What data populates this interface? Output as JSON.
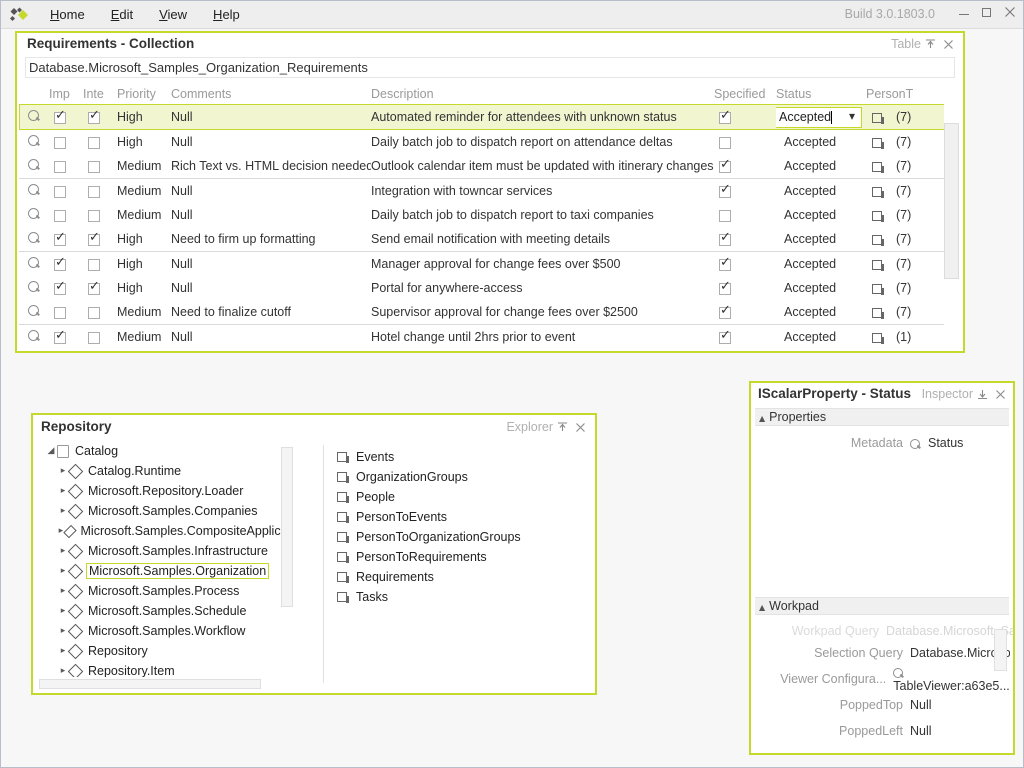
{
  "titlebar": {
    "logo_icon": "app-diamond-logo",
    "menus": [
      {
        "label": "Home",
        "accel": "H"
      },
      {
        "label": "Edit",
        "accel": "E"
      },
      {
        "label": "View",
        "accel": "V"
      },
      {
        "label": "Help",
        "accel": "H"
      }
    ],
    "build": "Build 3.0.1803.0",
    "minimize_icon": "minimize-icon",
    "maximize_icon": "maximize-icon",
    "close_icon": "close-icon"
  },
  "table_panel": {
    "title": "Requirements - Collection",
    "kind": "Table",
    "pin_icon": "pin-icon",
    "close_icon": "close-icon",
    "path": "Database.Microsoft_Samples_Organization_Requirements",
    "columns": [
      "",
      "Imp",
      "Inte",
      "Priority",
      "Comments",
      "Description",
      "Specified",
      "Status",
      "PersonT"
    ],
    "rows": [
      {
        "imp": true,
        "inte": true,
        "priority": "High",
        "comments": "Null",
        "description": "Automated reminder for attendees with unknown status",
        "specified": true,
        "status": "Accepted",
        "person": "(7)",
        "selected": true,
        "group_start": false
      },
      {
        "imp": false,
        "inte": false,
        "priority": "High",
        "comments": "Null",
        "description": "Daily batch job to dispatch report on attendance deltas",
        "specified": false,
        "status": "Accepted",
        "person": "(7)",
        "selected": false,
        "group_start": false
      },
      {
        "imp": false,
        "inte": false,
        "priority": "Medium",
        "comments": "Rich Text vs. HTML decision needed",
        "description": "Outlook calendar item must be updated with itinerary changes",
        "specified": true,
        "status": "Accepted",
        "person": "(7)",
        "selected": false,
        "group_start": false
      },
      {
        "imp": false,
        "inte": false,
        "priority": "Medium",
        "comments": "Null",
        "description": "Integration with towncar services",
        "specified": true,
        "status": "Accepted",
        "person": "(7)",
        "selected": false,
        "group_start": true
      },
      {
        "imp": false,
        "inte": false,
        "priority": "Medium",
        "comments": "Null",
        "description": "Daily batch job to dispatch report to taxi companies",
        "specified": false,
        "status": "Accepted",
        "person": "(7)",
        "selected": false,
        "group_start": false
      },
      {
        "imp": true,
        "inte": true,
        "priority": "High",
        "comments": "Need to firm up formatting",
        "description": "Send email notification with meeting details",
        "specified": true,
        "status": "Accepted",
        "person": "(7)",
        "selected": false,
        "group_start": false
      },
      {
        "imp": true,
        "inte": false,
        "priority": "High",
        "comments": "Null",
        "description": "Manager approval for change fees over $500",
        "specified": true,
        "status": "Accepted",
        "person": "(7)",
        "selected": false,
        "group_start": true
      },
      {
        "imp": true,
        "inte": true,
        "priority": "High",
        "comments": "Null",
        "description": "Portal for anywhere-access",
        "specified": true,
        "status": "Accepted",
        "person": "(7)",
        "selected": false,
        "group_start": false
      },
      {
        "imp": false,
        "inte": false,
        "priority": "Medium",
        "comments": "Need to finalize cutoff",
        "description": "Supervisor approval for change fees over $2500",
        "specified": true,
        "status": "Accepted",
        "person": "(7)",
        "selected": false,
        "group_start": false
      },
      {
        "imp": true,
        "inte": false,
        "priority": "Medium",
        "comments": "Null",
        "description": "Hotel change until 2hrs prior to event",
        "specified": true,
        "status": "Accepted",
        "person": "(1)",
        "selected": false,
        "group_start": true
      }
    ],
    "editing_status_value": "Accepted",
    "dropdown_icon": "chevron-down-icon",
    "row_action_icon": "magnifier-icon",
    "person_link_icon": "collection-icon"
  },
  "repository_panel": {
    "title": "Repository",
    "kind": "Explorer",
    "pin_icon": "pin-icon",
    "close_icon": "close-icon",
    "tree": [
      {
        "label": "Catalog",
        "level": 1,
        "icon": "book-icon",
        "expanded": true,
        "selected": false
      },
      {
        "label": "Catalog.Runtime",
        "level": 2,
        "icon": "diamond-icon",
        "expanded": false,
        "selected": false
      },
      {
        "label": "Microsoft.Repository.Loader",
        "level": 2,
        "icon": "diamond-icon",
        "expanded": false,
        "selected": false
      },
      {
        "label": "Microsoft.Samples.Companies",
        "level": 2,
        "icon": "diamond-icon",
        "expanded": false,
        "selected": false
      },
      {
        "label": "Microsoft.Samples.CompositeApplicat",
        "level": 2,
        "icon": "diamond-icon",
        "expanded": false,
        "selected": false
      },
      {
        "label": "Microsoft.Samples.Infrastructure",
        "level": 2,
        "icon": "diamond-icon",
        "expanded": false,
        "selected": false
      },
      {
        "label": "Microsoft.Samples.Organization",
        "level": 2,
        "icon": "diamond-icon",
        "expanded": false,
        "selected": true
      },
      {
        "label": "Microsoft.Samples.Process",
        "level": 2,
        "icon": "diamond-icon",
        "expanded": false,
        "selected": false
      },
      {
        "label": "Microsoft.Samples.Schedule",
        "level": 2,
        "icon": "diamond-icon",
        "expanded": false,
        "selected": false
      },
      {
        "label": "Microsoft.Samples.Workflow",
        "level": 2,
        "icon": "diamond-icon",
        "expanded": false,
        "selected": false
      },
      {
        "label": "Repository",
        "level": 2,
        "icon": "diamond-icon",
        "expanded": false,
        "selected": false
      },
      {
        "label": "Repository.Item",
        "level": 2,
        "icon": "diamond-icon",
        "expanded": false,
        "selected": false
      }
    ],
    "items": [
      {
        "label": "Events",
        "icon": "collection-icon"
      },
      {
        "label": "OrganizationGroups",
        "icon": "collection-icon"
      },
      {
        "label": "People",
        "icon": "collection-icon"
      },
      {
        "label": "PersonToEvents",
        "icon": "collection-icon"
      },
      {
        "label": "PersonToOrganizationGroups",
        "icon": "collection-icon"
      },
      {
        "label": "PersonToRequirements",
        "icon": "collection-icon"
      },
      {
        "label": "Requirements",
        "icon": "collection-icon"
      },
      {
        "label": "Tasks",
        "icon": "collection-icon"
      }
    ]
  },
  "inspector_panel": {
    "title": "IScalarProperty - Status",
    "kind": "Inspector",
    "pin_icon": "pin-icon",
    "close_icon": "close-icon",
    "properties_section": "Properties",
    "workpad_section": "Workpad",
    "properties": [
      {
        "label": "Metadata",
        "value": "Status",
        "icon": "magnifier-icon"
      }
    ],
    "workpad": [
      {
        "label": "Workpad Query",
        "value": "Database.Microsoft_Sam...",
        "icon": null,
        "clipped": true
      },
      {
        "label": "Selection Query",
        "value": "Database.Microsoft_Sam",
        "icon": null,
        "clipped": false
      },
      {
        "label": "Viewer Configura...",
        "value": "TableViewer:a63e5...",
        "icon": "magnifier-icon",
        "clipped": false
      },
      {
        "label": "PoppedTop",
        "value": "Null",
        "icon": null,
        "clipped": false
      },
      {
        "label": "PoppedLeft",
        "value": "Null",
        "icon": null,
        "clipped": false
      }
    ]
  },
  "colors": {
    "accent": "#c5d92d",
    "selection_fill": "#f1f6d0",
    "chrome": "#eeeeee",
    "text": "#333333",
    "muted": "#9a9a9a"
  }
}
